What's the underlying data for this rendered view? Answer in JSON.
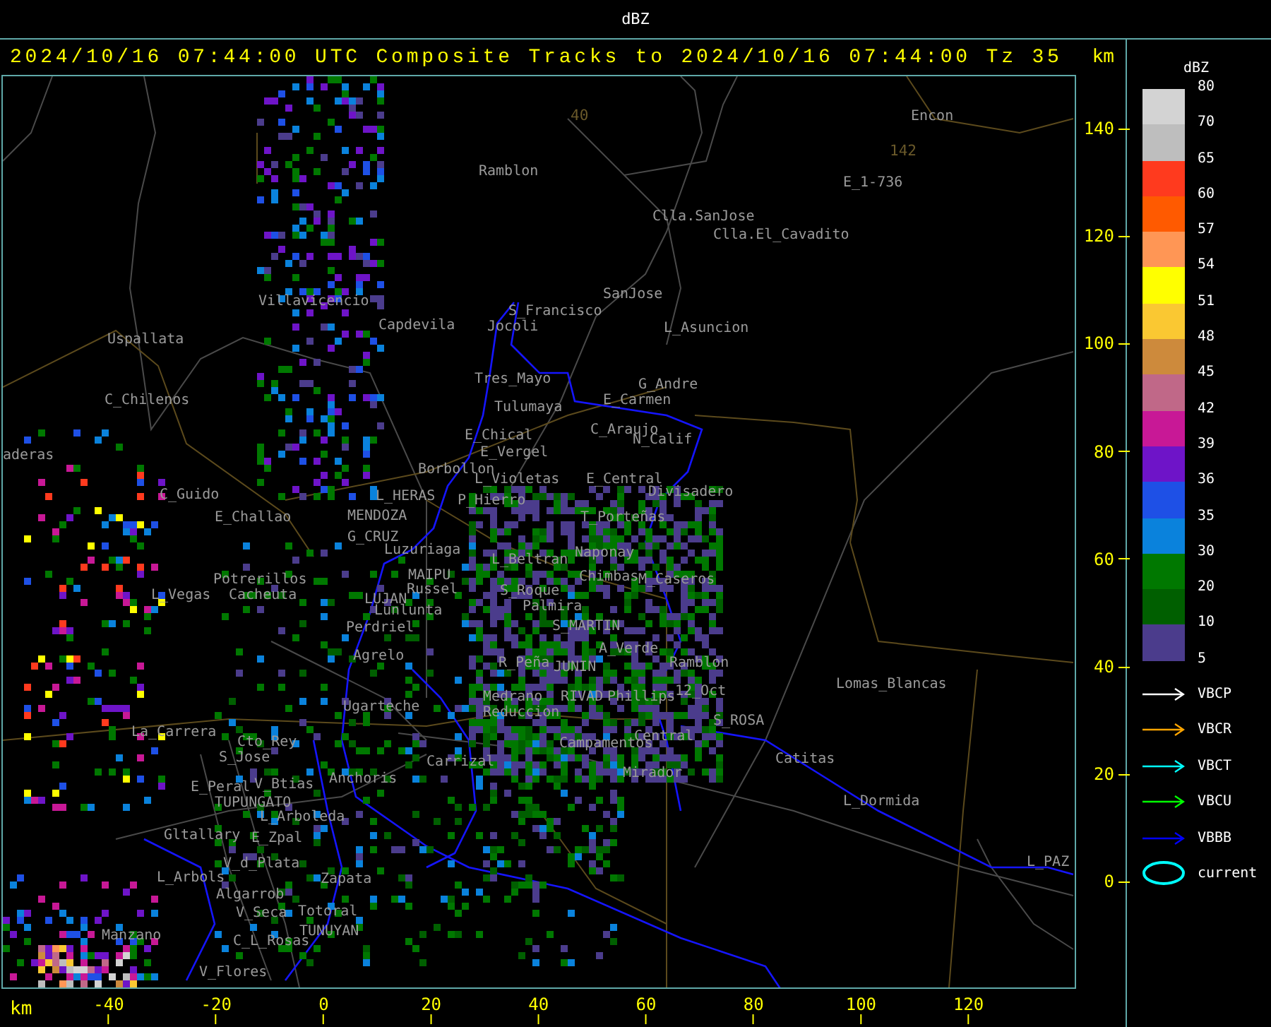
{
  "header": {
    "title": "dBZ"
  },
  "title_bar": {
    "title": "2024/10/16 07:44:00 UTC Composite Tracks to 2024/10/16 07:44:00 Tz 35",
    "unit": "km"
  },
  "map": {
    "places": [
      {
        "name": "Encon"
      },
      {
        "name": "Ramblon"
      },
      {
        "name": "E_1-736"
      },
      {
        "name": "Clla.SanJose"
      },
      {
        "name": "Clla.El_Cavadito"
      },
      {
        "name": "Villavicencio"
      },
      {
        "name": "SanJose"
      },
      {
        "name": "S_Francisco"
      },
      {
        "name": "Capdevila"
      },
      {
        "name": "Jocoli"
      },
      {
        "name": "L_Asuncion"
      },
      {
        "name": "Uspallata"
      },
      {
        "name": "Tres_Mayo"
      },
      {
        "name": "G_Andre"
      },
      {
        "name": "C_Chilenos"
      },
      {
        "name": "Tulumaya"
      },
      {
        "name": "E_Carmen"
      },
      {
        "name": "E_Chical"
      },
      {
        "name": "C_Araujo"
      },
      {
        "name": "N_Calif"
      },
      {
        "name": "aderas"
      },
      {
        "name": "E_Vergel"
      },
      {
        "name": "Borbollon"
      },
      {
        "name": "L_Violetas"
      },
      {
        "name": "E_Central"
      },
      {
        "name": "C_Guido"
      },
      {
        "name": "L_HERAS"
      },
      {
        "name": "P_Hierro"
      },
      {
        "name": "Divisadero"
      },
      {
        "name": "E_Challao"
      },
      {
        "name": "MENDOZA"
      },
      {
        "name": "T_Porteñas"
      },
      {
        "name": "G_CRUZ"
      },
      {
        "name": "Luzuriaga"
      },
      {
        "name": "L_Beltran"
      },
      {
        "name": "Naponay"
      },
      {
        "name": "Potrerillos"
      },
      {
        "name": "MAIPU"
      },
      {
        "name": "Chimbas"
      },
      {
        "name": "M_Caseros"
      },
      {
        "name": "L_Vegas"
      },
      {
        "name": "Cacheuta"
      },
      {
        "name": "LUJAN"
      },
      {
        "name": "Russel"
      },
      {
        "name": "S_Roque"
      },
      {
        "name": "Lunlunta"
      },
      {
        "name": "Palmira"
      },
      {
        "name": "Perdriel"
      },
      {
        "name": "S_MARTIN"
      },
      {
        "name": "Agrelo"
      },
      {
        "name": "R_Peña"
      },
      {
        "name": "JUNIN"
      },
      {
        "name": "A_Verde"
      },
      {
        "name": "Ramblon"
      },
      {
        "name": "Medrano"
      },
      {
        "name": "RIVAD"
      },
      {
        "name": "Phillips"
      },
      {
        "name": "12_Oct"
      },
      {
        "name": "Lomas_Blancas"
      },
      {
        "name": "Ugarteche"
      },
      {
        "name": "Reduccion"
      },
      {
        "name": "S_ROSA"
      },
      {
        "name": "La_Carrera"
      },
      {
        "name": "Cto_Rey"
      },
      {
        "name": "Campamentos"
      },
      {
        "name": "Central"
      },
      {
        "name": "S_Jose"
      },
      {
        "name": "Carrizal"
      },
      {
        "name": "Catitas"
      },
      {
        "name": "E_Peral"
      },
      {
        "name": "V_Btias"
      },
      {
        "name": "Anchoris"
      },
      {
        "name": "Mirador"
      },
      {
        "name": "TUPUNGATO"
      },
      {
        "name": "L_Dormida"
      },
      {
        "name": "L_Arboleda"
      },
      {
        "name": "Gltallary"
      },
      {
        "name": "E_Zpal"
      },
      {
        "name": "V_d_Plata"
      },
      {
        "name": "L_PAZ"
      },
      {
        "name": "L_Arbols"
      },
      {
        "name": "Zapata"
      },
      {
        "name": "Algarrob"
      },
      {
        "name": "V_Seca"
      },
      {
        "name": "Totoral"
      },
      {
        "name": "Manzano"
      },
      {
        "name": "C_L_Rosas"
      },
      {
        "name": "TUNUYAN"
      },
      {
        "name": "V_Flores"
      }
    ],
    "routes": [
      {
        "number": "40"
      },
      {
        "number": "142"
      }
    ]
  },
  "y_axis": {
    "ticks": [
      "140",
      "120",
      "100",
      "80",
      "60",
      "40",
      "20",
      "0"
    ]
  },
  "x_axis": {
    "unit": "km",
    "ticks": [
      "-40",
      "-20",
      "0",
      "20",
      "40",
      "60",
      "80",
      "100",
      "120"
    ]
  },
  "legend": {
    "title": "dBZ",
    "bins": [
      {
        "label": "80",
        "color": "#d3d3d3"
      },
      {
        "label": "70",
        "color": "#bebebe"
      },
      {
        "label": "65",
        "color": "#ff3a1e"
      },
      {
        "label": "60",
        "color": "#ff5a00"
      },
      {
        "label": "57",
        "color": "#ff9655"
      },
      {
        "label": "54",
        "color": "#ffff00"
      },
      {
        "label": "51",
        "color": "#fac832"
      },
      {
        "label": "48",
        "color": "#cd8a3c"
      },
      {
        "label": "45",
        "color": "#c06888"
      },
      {
        "label": "42",
        "color": "#c81896"
      },
      {
        "label": "39",
        "color": "#6e14c8"
      },
      {
        "label": "36",
        "color": "#1e50e6"
      },
      {
        "label": "35",
        "color": "#0a82dc"
      },
      {
        "label": "30",
        "color": "#007800"
      },
      {
        "label": "20",
        "color": "#005f00"
      },
      {
        "label": "10",
        "color": "#4b3c8c"
      }
    ],
    "bottom_label": "5",
    "tracks": [
      {
        "kind": "arrow",
        "name": "VBCP",
        "color": "#ffffff"
      },
      {
        "kind": "arrow",
        "name": "VBCR",
        "color": "#ffa500"
      },
      {
        "kind": "arrow",
        "name": "VBCT",
        "color": "#00ffff"
      },
      {
        "kind": "arrow",
        "name": "VBCU",
        "color": "#00ff00"
      },
      {
        "kind": "arrow",
        "name": "VBBB",
        "color": "#0000ff"
      },
      {
        "kind": "ellipse",
        "name": "current",
        "color": "#00ffff"
      }
    ]
  }
}
